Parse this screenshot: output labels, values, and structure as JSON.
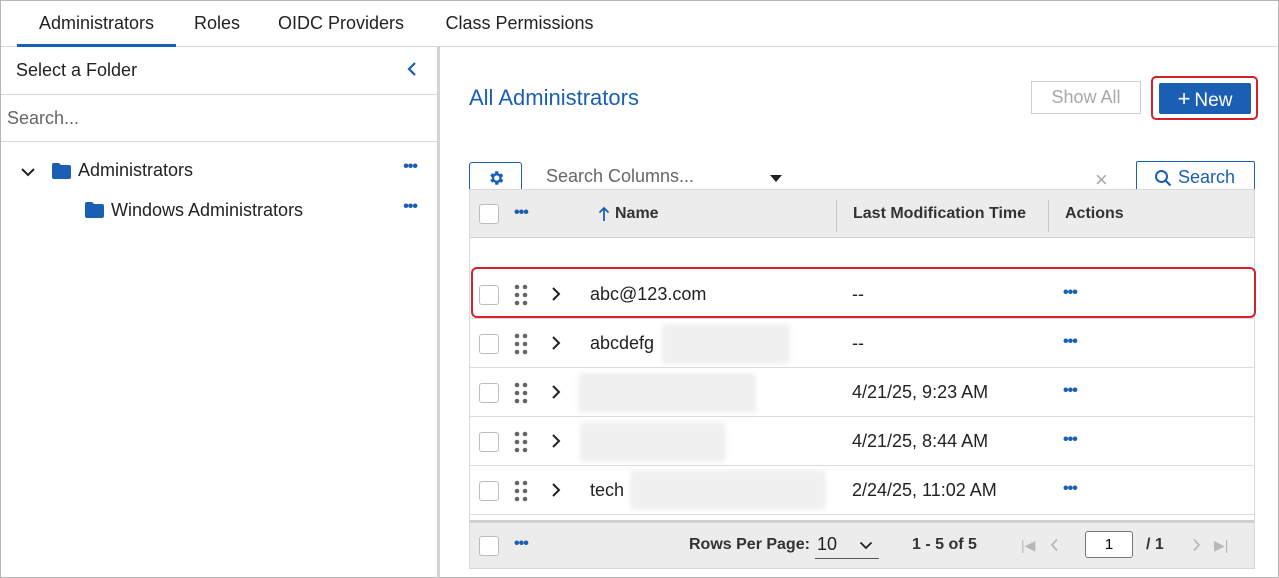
{
  "tabs": [
    {
      "label": "Administrators",
      "active": true
    },
    {
      "label": "Roles",
      "active": false
    },
    {
      "label": "OIDC Providers",
      "active": false
    },
    {
      "label": "Class Permissions",
      "active": false
    }
  ],
  "left_panel": {
    "title": "Select a Folder",
    "search_placeholder": "Search...",
    "tree": [
      {
        "label": "Administrators",
        "expanded": true,
        "level": 0
      },
      {
        "label": "Windows Administrators",
        "level": 1
      }
    ]
  },
  "main": {
    "title": "All Administrators",
    "show_all_label": "Show All",
    "new_label": "New",
    "column_search_placeholder": "Search Columns...",
    "search_label": "Search",
    "table": {
      "columns": [
        "Name",
        "Last Modification Time",
        "Actions"
      ],
      "sort_column": "Name",
      "rows": [
        {
          "name": "abc@123.com",
          "time": "--"
        },
        {
          "name": "abcdefg",
          "time": "--"
        },
        {
          "name": "",
          "time": "4/21/25, 9:23 AM"
        },
        {
          "name": "",
          "time": "4/21/25, 8:44 AM"
        },
        {
          "name": "tech",
          "time": "2/24/25, 11:02 AM"
        }
      ]
    },
    "footer": {
      "rows_per_page_label": "Rows Per Page:",
      "rows_per_page": "10",
      "range": "1 - 5 of 5",
      "page": "1",
      "total_pages": "/ 1"
    }
  },
  "colors": {
    "accent": "#1a5fb4",
    "highlight": "#d4222b"
  }
}
